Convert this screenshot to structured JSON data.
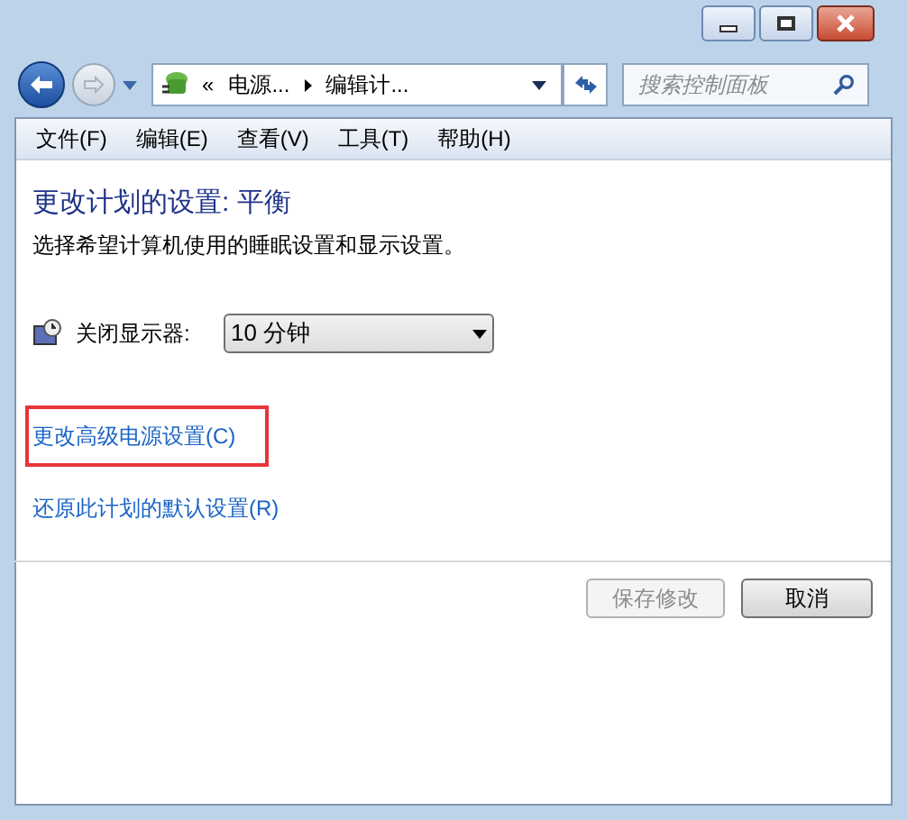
{
  "address_bar": {
    "prefix": "«",
    "crumbs": [
      "电源...",
      "编辑计..."
    ]
  },
  "search": {
    "placeholder": "搜索控制面板"
  },
  "menu": [
    "文件(F)",
    "编辑(E)",
    "查看(V)",
    "工具(T)",
    "帮助(H)"
  ],
  "heading": "更改计划的设置: 平衡",
  "description": "选择希望计算机使用的睡眠设置和显示设置。",
  "settings": [
    {
      "label": "关闭显示器:",
      "value": "10 分钟"
    }
  ],
  "links": [
    {
      "text": "更改高级电源设置(C)",
      "highlighted": true
    },
    {
      "text": "还原此计划的默认设置(R)",
      "highlighted": false
    }
  ],
  "buttons": [
    {
      "label": "保存修改",
      "disabled": true
    },
    {
      "label": "取消",
      "disabled": false
    }
  ]
}
